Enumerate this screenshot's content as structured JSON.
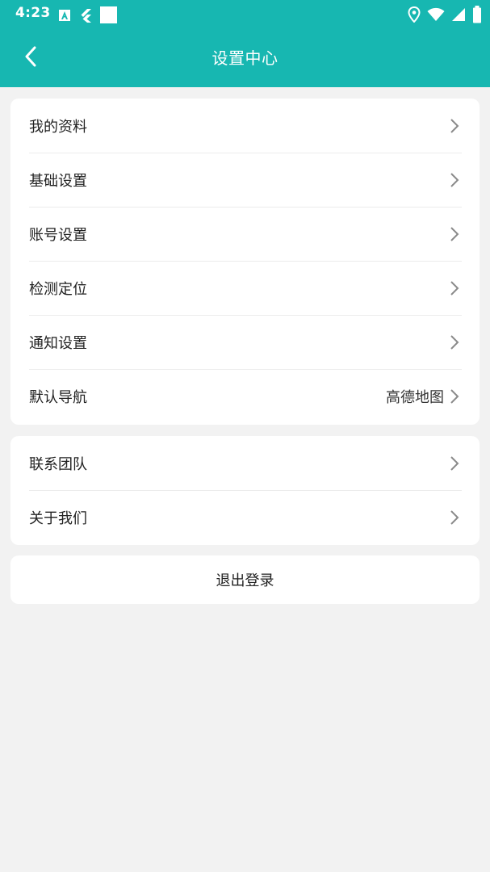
{
  "status_bar": {
    "time": "4:23"
  },
  "header": {
    "title": "设置中心"
  },
  "group1": {
    "items": [
      {
        "label": "我的资料",
        "value": ""
      },
      {
        "label": "基础设置",
        "value": ""
      },
      {
        "label": "账号设置",
        "value": ""
      },
      {
        "label": "检测定位",
        "value": ""
      },
      {
        "label": "通知设置",
        "value": ""
      },
      {
        "label": "默认导航",
        "value": "高德地图"
      }
    ]
  },
  "group2": {
    "items": [
      {
        "label": "联系团队"
      },
      {
        "label": "关于我们"
      }
    ]
  },
  "logout": {
    "label": "退出登录"
  },
  "colors": {
    "primary": "#17b7b1",
    "background": "#f2f2f2",
    "card": "#ffffff"
  }
}
